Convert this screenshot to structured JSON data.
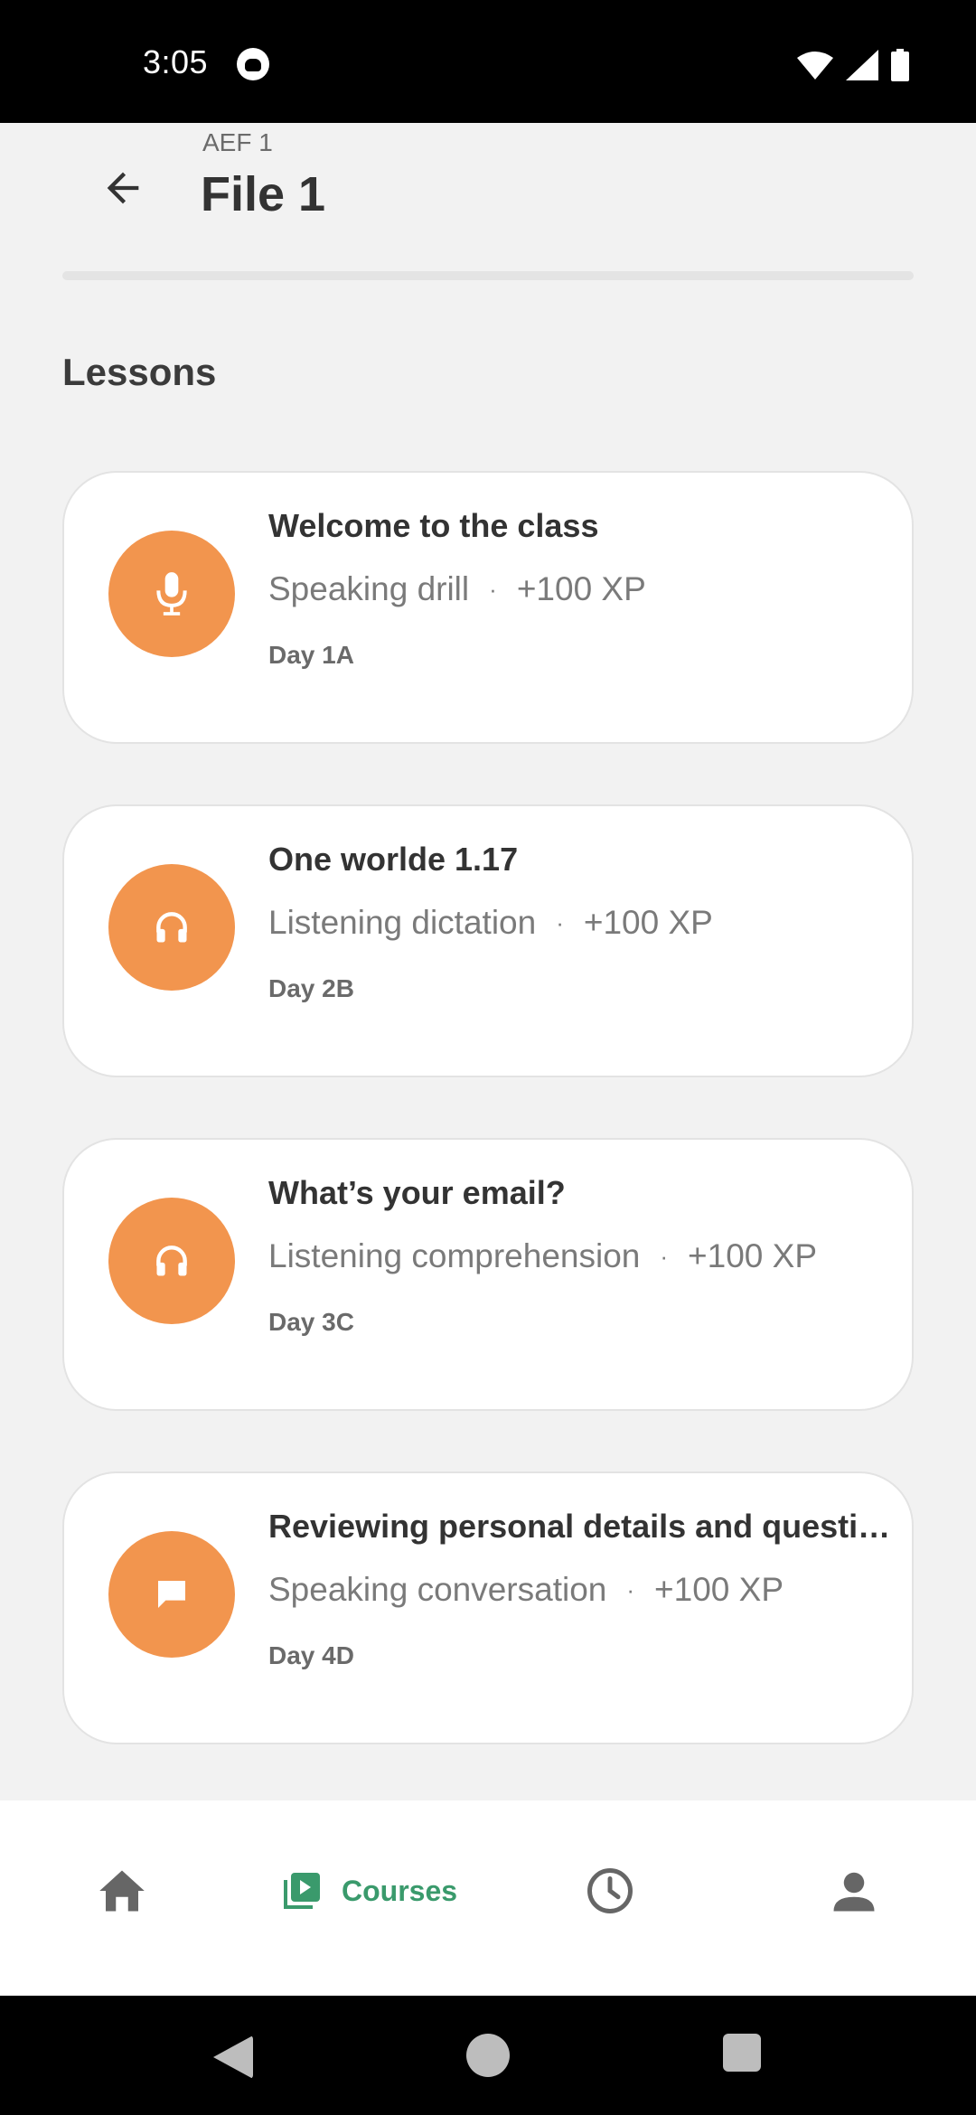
{
  "status_bar": {
    "time": "3:05"
  },
  "header": {
    "subtitle": "AEF 1",
    "title": "File 1"
  },
  "section": {
    "title": "Lessons"
  },
  "lessons": [
    {
      "title": "Welcome to the class",
      "type": "Speaking drill",
      "xp": "+100 XP",
      "day": "Day 1A",
      "icon": "microphone-icon"
    },
    {
      "title": "One worlde 1.17",
      "type": "Listening dictation",
      "xp": "+100 XP",
      "day": "Day 2B",
      "icon": "headphones-icon"
    },
    {
      "title": "What’s your email?",
      "type": "Listening comprehension",
      "xp": "+100 XP",
      "day": "Day 3C",
      "icon": "headphones-icon"
    },
    {
      "title": "Reviewing personal details and questions",
      "type": "Speaking conversation",
      "xp": "+100 XP",
      "day": "Day 4D",
      "icon": "chat-bubble-icon"
    }
  ],
  "meta_separator": "·",
  "bottom_nav": {
    "items": [
      {
        "icon": "home-icon",
        "label": ""
      },
      {
        "icon": "courses-icon",
        "label": "Courses"
      },
      {
        "icon": "clock-icon",
        "label": ""
      },
      {
        "icon": "profile-icon",
        "label": ""
      }
    ],
    "active_color": "#3a9a6c"
  },
  "colors": {
    "accent": "#f2954e",
    "background": "#f2f2f2"
  }
}
